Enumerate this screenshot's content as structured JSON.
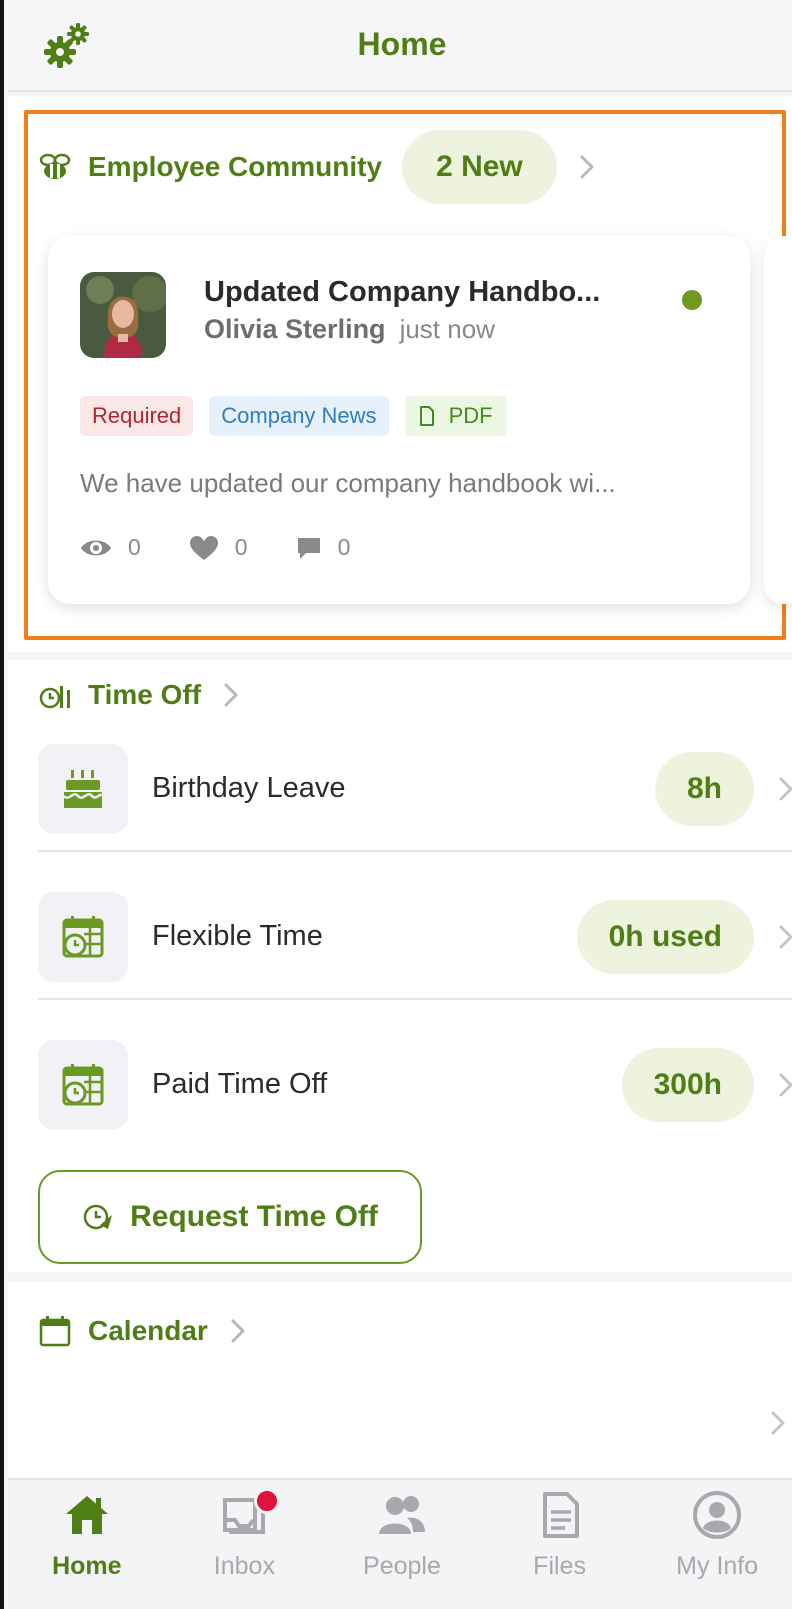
{
  "header": {
    "title": "Home",
    "settings_icon": "gear-icon"
  },
  "community": {
    "label": "Employee Community",
    "new_badge": "2 New",
    "post": {
      "title": "Updated Company Handbo...",
      "author": "Olivia Sterling",
      "time": "just now",
      "tags": {
        "required": "Required",
        "news": "Company News",
        "pdf": "PDF"
      },
      "excerpt": "We have updated our company handbook wi...",
      "views": "0",
      "likes": "0",
      "comments": "0"
    }
  },
  "time_off": {
    "label": "Time Off",
    "items": [
      {
        "name": "Birthday Leave",
        "value": "8h",
        "icon": "birthday-cake-icon"
      },
      {
        "name": "Flexible Time",
        "value": "0h used",
        "icon": "calendar-clock-icon"
      },
      {
        "name": "Paid Time Off",
        "value": "300h",
        "icon": "calendar-clock-icon"
      }
    ],
    "request_button": "Request Time Off"
  },
  "calendar": {
    "label": "Calendar"
  },
  "tabs": [
    {
      "label": "Home",
      "icon": "home-icon",
      "active": true
    },
    {
      "label": "Inbox",
      "icon": "inbox-icon",
      "badge": true
    },
    {
      "label": "People",
      "icon": "people-icon"
    },
    {
      "label": "Files",
      "icon": "files-icon"
    },
    {
      "label": "My Info",
      "icon": "user-icon"
    }
  ],
  "colors": {
    "brand": "#4e7e15",
    "pill_bg": "#edf3dd",
    "highlight": "#f07f1a",
    "badge": "#e2123f"
  }
}
